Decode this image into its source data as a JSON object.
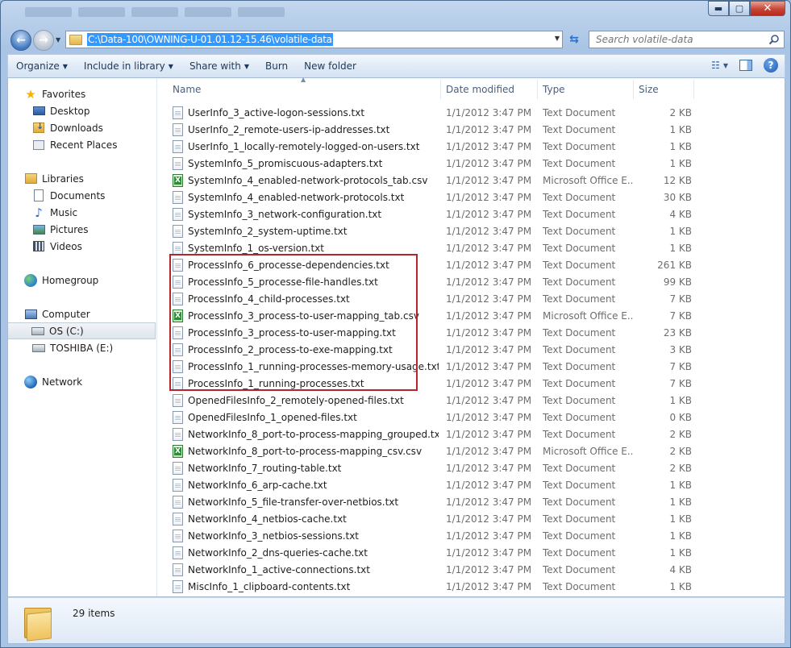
{
  "window": {
    "controls": {
      "minimize": "▬",
      "maximize": "▢",
      "close": "✕"
    }
  },
  "address": {
    "path": "C:\\Data-100\\OWNING-U-01.01.12-15.46\\volatile-data",
    "search_placeholder": "Search volatile-data"
  },
  "toolbar": {
    "organize": "Organize",
    "include_in_library": "Include in library",
    "share_with": "Share with",
    "burn": "Burn",
    "new_folder": "New folder"
  },
  "nav": {
    "favorites": "Favorites",
    "desktop": "Desktop",
    "downloads": "Downloads",
    "recent_places": "Recent Places",
    "libraries": "Libraries",
    "documents": "Documents",
    "music": "Music",
    "pictures": "Pictures",
    "videos": "Videos",
    "homegroup": "Homegroup",
    "computer": "Computer",
    "os_c": "OS (C:)",
    "toshiba_e": "TOSHIBA (E:)",
    "network": "Network"
  },
  "columns": {
    "name": "Name",
    "date": "Date modified",
    "type": "Type",
    "size": "Size"
  },
  "files": [
    {
      "name": "UserInfo_3_active-logon-sessions.txt",
      "date": "1/1/2012 3:47 PM",
      "type": "Text Document",
      "size": "2 KB",
      "kind": "txt"
    },
    {
      "name": "UserInfo_2_remote-users-ip-addresses.txt",
      "date": "1/1/2012 3:47 PM",
      "type": "Text Document",
      "size": "1 KB",
      "kind": "txt"
    },
    {
      "name": "UserInfo_1_locally-remotely-logged-on-users.txt",
      "date": "1/1/2012 3:47 PM",
      "type": "Text Document",
      "size": "1 KB",
      "kind": "txt"
    },
    {
      "name": "SystemInfo_5_promiscuous-adapters.txt",
      "date": "1/1/2012 3:47 PM",
      "type": "Text Document",
      "size": "1 KB",
      "kind": "txt"
    },
    {
      "name": "SystemInfo_4_enabled-network-protocols_tab.csv",
      "date": "1/1/2012 3:47 PM",
      "type": "Microsoft Office E...",
      "size": "12 KB",
      "kind": "csv"
    },
    {
      "name": "SystemInfo_4_enabled-network-protocols.txt",
      "date": "1/1/2012 3:47 PM",
      "type": "Text Document",
      "size": "30 KB",
      "kind": "txt"
    },
    {
      "name": "SystemInfo_3_network-configuration.txt",
      "date": "1/1/2012 3:47 PM",
      "type": "Text Document",
      "size": "4 KB",
      "kind": "txt"
    },
    {
      "name": "SystemInfo_2_system-uptime.txt",
      "date": "1/1/2012 3:47 PM",
      "type": "Text Document",
      "size": "1 KB",
      "kind": "txt"
    },
    {
      "name": "SystemInfo_1_os-version.txt",
      "date": "1/1/2012 3:47 PM",
      "type": "Text Document",
      "size": "1 KB",
      "kind": "txt"
    },
    {
      "name": "ProcessInfo_6_processe-dependencies.txt",
      "date": "1/1/2012 3:47 PM",
      "type": "Text Document",
      "size": "261 KB",
      "kind": "txt"
    },
    {
      "name": "ProcessInfo_5_processe-file-handles.txt",
      "date": "1/1/2012 3:47 PM",
      "type": "Text Document",
      "size": "99 KB",
      "kind": "txt"
    },
    {
      "name": "ProcessInfo_4_child-processes.txt",
      "date": "1/1/2012 3:47 PM",
      "type": "Text Document",
      "size": "7 KB",
      "kind": "txt"
    },
    {
      "name": "ProcessInfo_3_process-to-user-mapping_tab.csv",
      "date": "1/1/2012 3:47 PM",
      "type": "Microsoft Office E...",
      "size": "7 KB",
      "kind": "csv"
    },
    {
      "name": "ProcessInfo_3_process-to-user-mapping.txt",
      "date": "1/1/2012 3:47 PM",
      "type": "Text Document",
      "size": "23 KB",
      "kind": "txt"
    },
    {
      "name": "ProcessInfo_2_process-to-exe-mapping.txt",
      "date": "1/1/2012 3:47 PM",
      "type": "Text Document",
      "size": "3 KB",
      "kind": "txt"
    },
    {
      "name": "ProcessInfo_1_running-processes-memory-usage.txt",
      "date": "1/1/2012 3:47 PM",
      "type": "Text Document",
      "size": "7 KB",
      "kind": "txt"
    },
    {
      "name": "ProcessInfo_1_running-processes.txt",
      "date": "1/1/2012 3:47 PM",
      "type": "Text Document",
      "size": "7 KB",
      "kind": "txt"
    },
    {
      "name": "OpenedFilesInfo_2_remotely-opened-files.txt",
      "date": "1/1/2012 3:47 PM",
      "type": "Text Document",
      "size": "1 KB",
      "kind": "txt"
    },
    {
      "name": "OpenedFilesInfo_1_opened-files.txt",
      "date": "1/1/2012 3:47 PM",
      "type": "Text Document",
      "size": "0 KB",
      "kind": "txt"
    },
    {
      "name": "NetworkInfo_8_port-to-process-mapping_grouped.txt",
      "date": "1/1/2012 3:47 PM",
      "type": "Text Document",
      "size": "2 KB",
      "kind": "txt"
    },
    {
      "name": "NetworkInfo_8_port-to-process-mapping_csv.csv",
      "date": "1/1/2012 3:47 PM",
      "type": "Microsoft Office E...",
      "size": "2 KB",
      "kind": "csv"
    },
    {
      "name": "NetworkInfo_7_routing-table.txt",
      "date": "1/1/2012 3:47 PM",
      "type": "Text Document",
      "size": "2 KB",
      "kind": "txt"
    },
    {
      "name": "NetworkInfo_6_arp-cache.txt",
      "date": "1/1/2012 3:47 PM",
      "type": "Text Document",
      "size": "1 KB",
      "kind": "txt"
    },
    {
      "name": "NetworkInfo_5_file-transfer-over-netbios.txt",
      "date": "1/1/2012 3:47 PM",
      "type": "Text Document",
      "size": "1 KB",
      "kind": "txt"
    },
    {
      "name": "NetworkInfo_4_netbios-cache.txt",
      "date": "1/1/2012 3:47 PM",
      "type": "Text Document",
      "size": "1 KB",
      "kind": "txt"
    },
    {
      "name": "NetworkInfo_3_netbios-sessions.txt",
      "date": "1/1/2012 3:47 PM",
      "type": "Text Document",
      "size": "1 KB",
      "kind": "txt"
    },
    {
      "name": "NetworkInfo_2_dns-queries-cache.txt",
      "date": "1/1/2012 3:47 PM",
      "type": "Text Document",
      "size": "1 KB",
      "kind": "txt"
    },
    {
      "name": "NetworkInfo_1_active-connections.txt",
      "date": "1/1/2012 3:47 PM",
      "type": "Text Document",
      "size": "4 KB",
      "kind": "txt"
    },
    {
      "name": "MiscInfo_1_clipboard-contents.txt",
      "date": "1/1/2012 3:47 PM",
      "type": "Text Document",
      "size": "1 KB",
      "kind": "txt"
    }
  ],
  "highlight_color": "#b4262a",
  "status": {
    "items_count": "29 items"
  }
}
